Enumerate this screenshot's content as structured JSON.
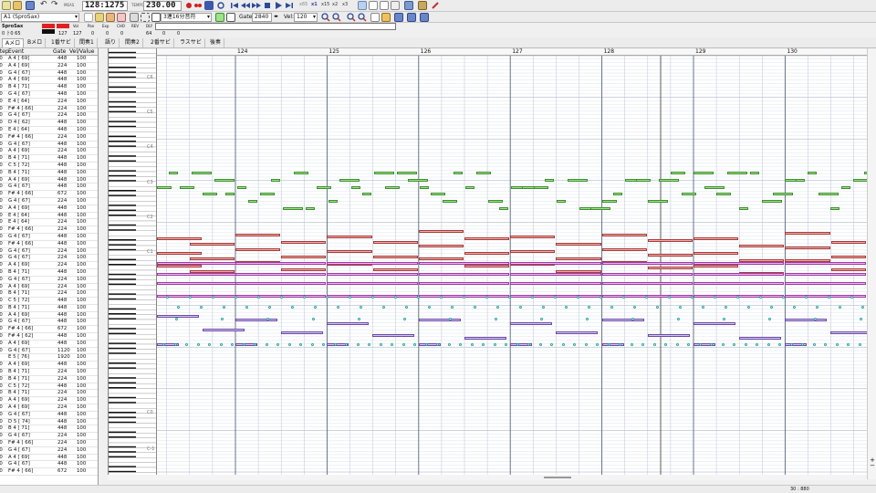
{
  "toolbar": {
    "position": "128:1275",
    "tempo_label": "TEMPO",
    "tempo": "230.00",
    "meas_label": "MEAS",
    "zoom_buttons": [
      "x65",
      "x1",
      "x15",
      "x2",
      "x3"
    ]
  },
  "toolbar2": {
    "track_select": "A1 (SproSax)",
    "note_length": "3連16分音符",
    "gate_label": "Gate:",
    "gate_value": "2840",
    "vel_label": "Vel:",
    "vel_value": "120"
  },
  "mixer": {
    "track_name": "SproSax",
    "headers": [
      "Vol",
      "Pan",
      "Exp",
      "CHO",
      "REV",
      "DLY",
      "MOD",
      "BRI",
      "FINE"
    ],
    "row1": "0  ㅏ0  65",
    "values": [
      "127",
      "127",
      "0",
      "0",
      "0",
      "64",
      "0",
      "0"
    ]
  },
  "tabs": [
    "Aメロ",
    "Bメロ",
    "1番サビ",
    "間奏1",
    "語り",
    "間奏2",
    "2番サビ",
    "ラスサビ",
    "後奏"
  ],
  "event_list": {
    "headers": [
      "Step",
      "Event",
      "Gate",
      "Vel/Value"
    ],
    "rows": [
      [
        "40",
        "A  4 [ 69]",
        "448",
        "100"
      ],
      [
        "40",
        "A  4 [ 69]",
        "224",
        "100"
      ],
      [
        "40",
        "G  4 [ 67]",
        "448",
        "100"
      ],
      [
        "40",
        "A  4 [ 69]",
        "448",
        "100"
      ],
      [
        "40",
        "B  4 [ 71]",
        "448",
        "100"
      ],
      [
        "20",
        "G  4 [ 67]",
        "448",
        "100"
      ],
      [
        "40",
        "E  4 [ 64]",
        "224",
        "100"
      ],
      [
        "40",
        "F# 4 [ 66]",
        "224",
        "100"
      ],
      [
        "40",
        "G  4 [ 67]",
        "224",
        "100"
      ],
      [
        "40",
        "D  4 [ 62]",
        "448",
        "100"
      ],
      [
        "40",
        "E  4 [ 64]",
        "448",
        "100"
      ],
      [
        "20",
        "F# 4 [ 66]",
        "224",
        "100"
      ],
      [
        "40",
        "G  4 [ 67]",
        "448",
        "100"
      ],
      [
        "40",
        "A  4 [ 69]",
        "224",
        "100"
      ],
      [
        "20",
        "B  4 [ 71]",
        "448",
        "100"
      ],
      [
        "40",
        "C  5 [ 72]",
        "448",
        "100"
      ],
      [
        "40",
        "B  4 [ 71]",
        "448",
        "100"
      ],
      [
        "40",
        "A  4 [ 69]",
        "448",
        "100"
      ],
      [
        "40",
        "G  4 [ 67]",
        "448",
        "100"
      ],
      [
        "20",
        "F# 4 [ 66]",
        "672",
        "100"
      ],
      [
        "40",
        "G  4 [ 67]",
        "224",
        "100"
      ],
      [
        "40",
        "A  4 [ 69]",
        "448",
        "100"
      ],
      [
        "40",
        "E  4 [ 64]",
        "448",
        "100"
      ],
      [
        "40",
        "E  4 [ 64]",
        "224",
        "100"
      ],
      [
        "80",
        "F# 4 [ 66]",
        "224",
        "100"
      ],
      [
        "40",
        "G  4 [ 67]",
        "448",
        "100"
      ],
      [
        "40",
        "F# 4 [ 66]",
        "448",
        "100"
      ],
      [
        "40",
        "G  4 [ 67]",
        "224",
        "100"
      ],
      [
        "40",
        "G  4 [ 67]",
        "224",
        "100"
      ],
      [
        "40",
        "A  4 [ 69]",
        "224",
        "100"
      ],
      [
        "40",
        "B  4 [ 71]",
        "448",
        "100"
      ],
      [
        "40",
        "G  4 [ 67]",
        "224",
        "100"
      ],
      [
        "40",
        "A  4 [ 69]",
        "224",
        "100"
      ],
      [
        "40",
        "B  4 [ 71]",
        "224",
        "100"
      ],
      [
        "40",
        "C  5 [ 72]",
        "448",
        "100"
      ],
      [
        "40",
        "B  4 [ 71]",
        "448",
        "100"
      ],
      [
        "40",
        "A  4 [ 69]",
        "448",
        "100"
      ],
      [
        "40",
        "G  4 [ 67]",
        "448",
        "100"
      ],
      [
        "20",
        "F# 4 [ 66]",
        "672",
        "100"
      ],
      [
        "40",
        "F# 4 [ 62]",
        "448",
        "100"
      ],
      [
        "40",
        "A  4 [ 69]",
        "448",
        "100"
      ],
      [
        "40",
        "G  4 [ 67]",
        "1120",
        "100"
      ],
      [
        "--",
        "E  5 [ 76]",
        "1920",
        "100"
      ],
      [
        "40",
        "A  4 [ 69]",
        "448",
        "100"
      ],
      [
        "40",
        "B  4 [ 71]",
        "224",
        "100"
      ],
      [
        "40",
        "B  4 [ 71]",
        "224",
        "100"
      ],
      [
        "40",
        "C  5 [ 72]",
        "448",
        "100"
      ],
      [
        "40",
        "B  4 [ 71]",
        "224",
        "100"
      ],
      [
        "40",
        "A  4 [ 69]",
        "224",
        "100"
      ],
      [
        "40",
        "A  4 [ 69]",
        "224",
        "100"
      ],
      [
        "40",
        "G  4 [ 67]",
        "448",
        "100"
      ],
      [
        "20",
        "D  5 [ 74]",
        "448",
        "100"
      ],
      [
        "40",
        "B  4 [ 71]",
        "448",
        "100"
      ],
      [
        "40",
        "G  4 [ 67]",
        "224",
        "100"
      ],
      [
        "40",
        "F# 4 [ 66]",
        "224",
        "100"
      ],
      [
        "40",
        "G  4 [ 67]",
        "224",
        "100"
      ],
      [
        "40",
        "A  4 [ 69]",
        "448",
        "100"
      ],
      [
        "40",
        "G  4 [ 67]",
        "448",
        "100"
      ],
      [
        "20",
        "F# 4 [ 66]",
        "672",
        "100"
      ]
    ]
  },
  "piano_labels": [
    "C6",
    "C5",
    "C4",
    "C3",
    "C2",
    "C1",
    "C0",
    "C-1"
  ],
  "ruler": {
    "measures": [
      "124",
      "125",
      "126",
      "127",
      "128",
      "129",
      "130"
    ]
  },
  "status": {
    "right_text": "30 : 880"
  },
  "colors": {
    "melody": "#9ee28a",
    "chord": "#f4b0a8",
    "pad": "#f0b4f2",
    "bass": "#d6c6f6",
    "drum": "#2aa6a0"
  }
}
